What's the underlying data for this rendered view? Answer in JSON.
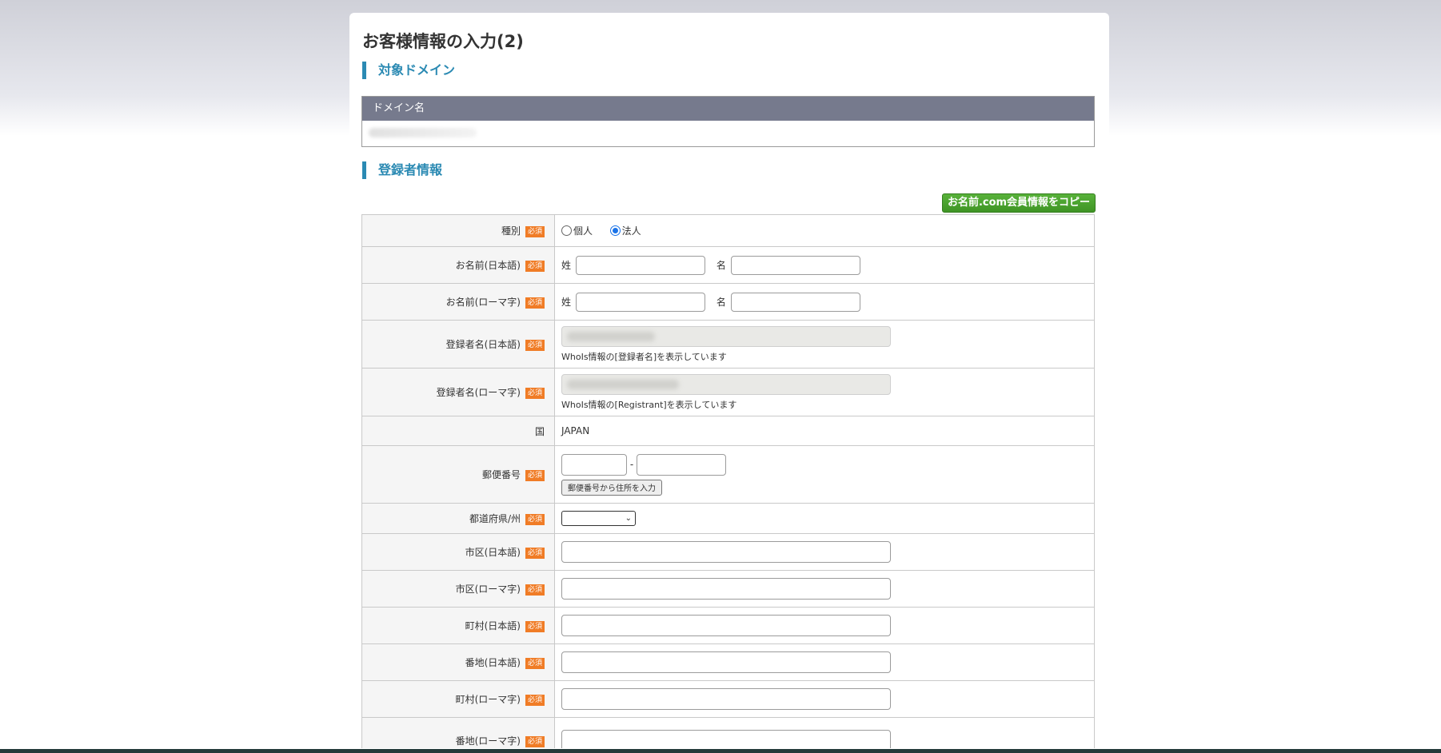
{
  "page": {
    "title": "お客様情報の入力(2)"
  },
  "sections": {
    "domain": "対象ドメイン",
    "registrant": "登録者情報"
  },
  "domain_table": {
    "header": "ドメイン名"
  },
  "copy_button_label": "お名前.com会員情報をコピー",
  "required_badge": "必須",
  "fields": {
    "type": {
      "label": "種別",
      "options": [
        {
          "label": "個人",
          "checked": false
        },
        {
          "label": "法人",
          "checked": true
        }
      ]
    },
    "name_jp": {
      "label": "お名前(日本語)",
      "sei": "姓",
      "mei": "名"
    },
    "name_romaji": {
      "label": "お名前(ローマ字)",
      "sei": "姓",
      "mei": "名"
    },
    "registrant_jp": {
      "label": "登録者名(日本語)",
      "hint": "WhoIs情報の[登録者名]を表示しています"
    },
    "registrant_romaji": {
      "label": "登録者名(ローマ字)",
      "hint": "WhoIs情報の[Registrant]を表示しています"
    },
    "country": {
      "label": "国",
      "value": "JAPAN"
    },
    "postal": {
      "label": "郵便番号",
      "separator": "-",
      "button": "郵便番号から住所を入力"
    },
    "prefecture": {
      "label": "都道府県/州"
    },
    "city_jp": {
      "label": "市区(日本語)"
    },
    "city_romaji": {
      "label": "市区(ローマ字)"
    },
    "town_jp": {
      "label": "町村(日本語)"
    },
    "address_jp": {
      "label": "番地(日本語)"
    },
    "town_romaji": {
      "label": "町村(ローマ字)"
    },
    "address_romaji": {
      "label": "番地(ローマ字)"
    }
  },
  "colors": {
    "accent": "#2b8ab3",
    "required": "#f07c26",
    "copy_button": "#4aa52f",
    "table_header": "#767a8d"
  }
}
